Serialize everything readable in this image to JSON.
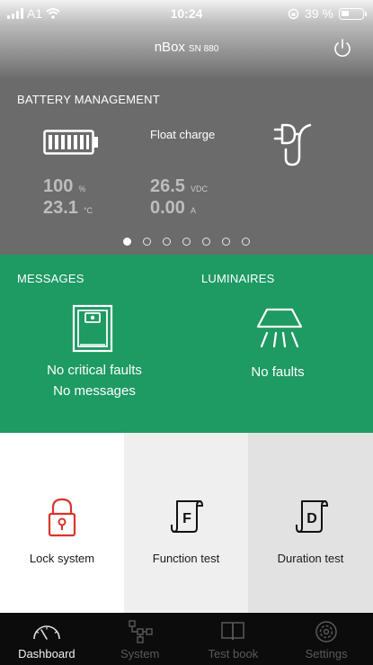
{
  "status_bar": {
    "carrier": "A1",
    "time": "10:24",
    "battery_percent": "39 %",
    "battery_level": 0.39
  },
  "header": {
    "title": "nBox",
    "serial": "SN 880",
    "power_icon": "power-icon"
  },
  "battery_management": {
    "title": "BATTERY MANAGEMENT",
    "charge_mode": "Float charge",
    "charge_level_value": "100",
    "charge_level_unit": "%",
    "temperature_value": "23.1",
    "temperature_unit": "°C",
    "voltage_value": "26.5",
    "voltage_unit": "VDC",
    "current_value": "0.00",
    "current_unit": "A",
    "page_count": 7,
    "active_page": 0,
    "icons": [
      "battery-full-icon",
      "plug-icon"
    ]
  },
  "messages": {
    "title": "MESSAGES",
    "line1": "No critical faults",
    "line2": "No messages",
    "icon": "cabinet-icon"
  },
  "luminaires": {
    "title": "LUMINAIRES",
    "status": "No faults",
    "icon": "luminaire-icon"
  },
  "actions": [
    {
      "label": "Lock system",
      "icon": "lock-icon",
      "bg": "#ffffff"
    },
    {
      "label": "Function test",
      "icon": "function-test-icon",
      "bg": "#efefef"
    },
    {
      "label": "Duration test",
      "icon": "duration-test-icon",
      "bg": "#e2e2e2"
    }
  ],
  "tabs": [
    {
      "label": "Dashboard",
      "icon": "gauge-icon",
      "active": true
    },
    {
      "label": "System",
      "icon": "network-icon",
      "active": false
    },
    {
      "label": "Test book",
      "icon": "book-icon",
      "active": false
    },
    {
      "label": "Settings",
      "icon": "settings-icon",
      "active": false
    }
  ],
  "colors": {
    "accent_green": "#1e9a63",
    "lock_red": "#d9342b",
    "panel_grey": "#6b6b6b",
    "tabbar": "#0c0c0c"
  }
}
